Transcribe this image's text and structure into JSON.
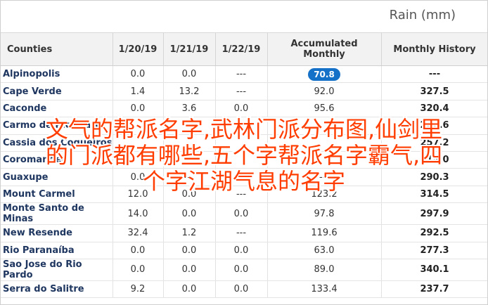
{
  "title": "Rain (mm)",
  "columns": [
    "Counties",
    "1/20/19",
    "1/21/19",
    "1/22/19",
    "Accumulated Monthly",
    "Monthly History"
  ],
  "rows": [
    [
      "Alpinopolis",
      "0.0",
      "0.0",
      "---",
      "70.8",
      "---"
    ],
    [
      "Cape Verde",
      "1.4",
      "13.2",
      "---",
      "92.0",
      "327.5"
    ],
    [
      "Caconde",
      "0.0",
      "3.6",
      "0.0",
      "95.6",
      "320.4"
    ],
    [
      "Carmo de Rio Claro",
      "",
      "",
      "",
      "",
      "282.6"
    ],
    [
      "Cassia dos Coqueiros",
      "",
      "",
      "",
      "",
      "257.2"
    ],
    [
      "Coromandel",
      "",
      "",
      "",
      "",
      "315.0"
    ],
    [
      "Guaxupe",
      "0.0",
      "---",
      "---",
      "---",
      "290.3"
    ],
    [
      "Mount Carmel",
      "12.0",
      "0.0",
      "---",
      "123.2",
      "314.5"
    ],
    [
      "Monte Santo de Minas",
      "14.0",
      "0.0",
      "0.0",
      "97.8",
      "297.9"
    ],
    [
      "New Resende",
      "32.4",
      "1.2",
      "---",
      "119.6",
      "292.5"
    ],
    [
      "Rio Paranaíba",
      "0.0",
      "0.0",
      "0.0",
      "63.0",
      "277.3"
    ],
    [
      "Sao Jose do Rio Pardo",
      "0.0",
      "0.0",
      "0.0",
      "89.0",
      "340.1"
    ],
    [
      "Serra do Salitre",
      "9.2",
      "0.0",
      "0.0",
      "133.4",
      "237.7"
    ]
  ],
  "highlight_color": "#1570c7",
  "overlay_lines": [
    "文气的帮派名字,武林门派分布图,仙剑里",
    "的门派都有哪些,五个字帮派名字霸气,四",
    "个字江湖气息的名字"
  ]
}
